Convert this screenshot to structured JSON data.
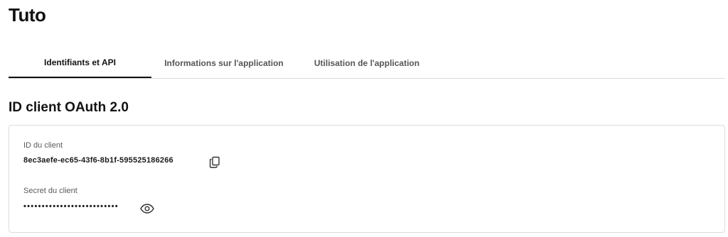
{
  "app": {
    "title": "Tuto"
  },
  "tabs": [
    {
      "label": "Identifiants et API",
      "active": true
    },
    {
      "label": "Informations sur l'application",
      "active": false
    },
    {
      "label": "Utilisation de l'application",
      "active": false
    }
  ],
  "section": {
    "title": "ID client OAuth 2.0"
  },
  "credentials": {
    "client_id_label": "ID du client",
    "client_id_value": "8ec3aefe-ec65-43f6-8b1f-595525186266",
    "client_secret_label": "Secret du client",
    "client_secret_masked": "••••••••••••••••••••••••••"
  },
  "icons": {
    "copy": "copy-icon",
    "reveal": "eye-icon"
  }
}
